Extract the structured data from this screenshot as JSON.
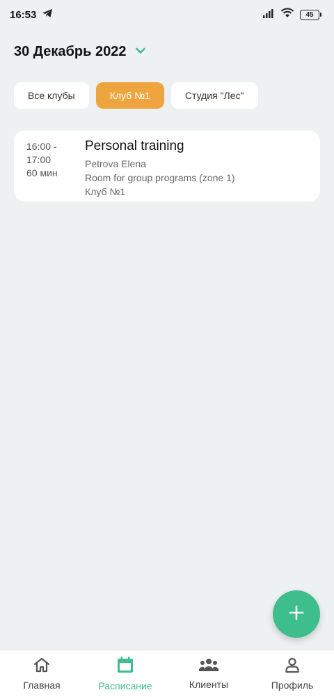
{
  "status_bar": {
    "time": "16:53",
    "battery": "45",
    "icons": [
      "telegram-icon",
      "signal-icon",
      "wifi-icon",
      "battery-icon"
    ]
  },
  "header": {
    "date": "30 Декабрь 2022",
    "dropdown_icon": "chevron-down-icon",
    "accent_color": "#3dbe8c"
  },
  "club_filters": [
    {
      "label": "Все клубы",
      "active": false
    },
    {
      "label": "Клуб №1",
      "active": true
    },
    {
      "label": "Студия \"Лес\"",
      "active": false
    }
  ],
  "active_chip_color": "#efa53f",
  "schedule": [
    {
      "time_range": "16:00 -",
      "time_end": "17:00",
      "duration": "60 мин",
      "title": "Personal training",
      "trainer": "Petrova Elena",
      "room": "Room for group programs (zone 1)",
      "club": "Клуб №1"
    }
  ],
  "fab": {
    "icon": "plus-icon"
  },
  "bottom_nav": [
    {
      "label": "Главная",
      "icon": "home-icon",
      "active": false
    },
    {
      "label": "Расписание",
      "icon": "calendar-icon",
      "active": true
    },
    {
      "label": "Клиенты",
      "icon": "clients-icon",
      "active": false
    },
    {
      "label": "Профиль",
      "icon": "profile-icon",
      "active": false
    }
  ]
}
